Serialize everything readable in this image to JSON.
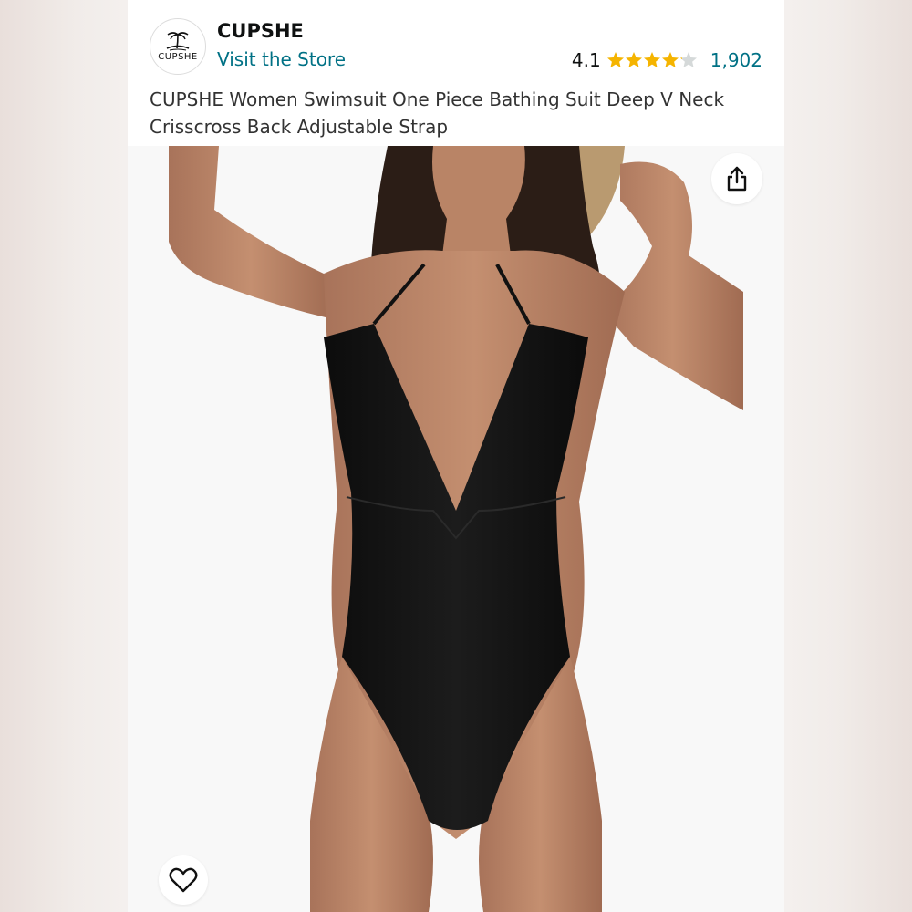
{
  "store": {
    "logo_text": "CUPSHE",
    "brand_name": "CUPSHE",
    "visit_label": "Visit the Store",
    "logo_icon": "palm-tree-island-icon"
  },
  "rating": {
    "value": "4.1",
    "stars": 4.1,
    "max_stars": 5,
    "count": "1,902",
    "star_color": "#f5b400",
    "empty_star_color": "#d5d9d9"
  },
  "product": {
    "title_line1": "CUPSHE Women Swimsuit One Piece Bathing Suit Deep V Neck",
    "title_line2": "Crisscross Back Adjustable Strap",
    "image_subject": "woman wearing black one-piece swimsuit and straw hat"
  },
  "actions": {
    "share_icon": "share-icon",
    "favorite_icon": "heart-outline-icon"
  },
  "colors": {
    "link": "#007185",
    "text": "#0f1111",
    "swimsuit": "#121212",
    "skin": "#b98466"
  }
}
